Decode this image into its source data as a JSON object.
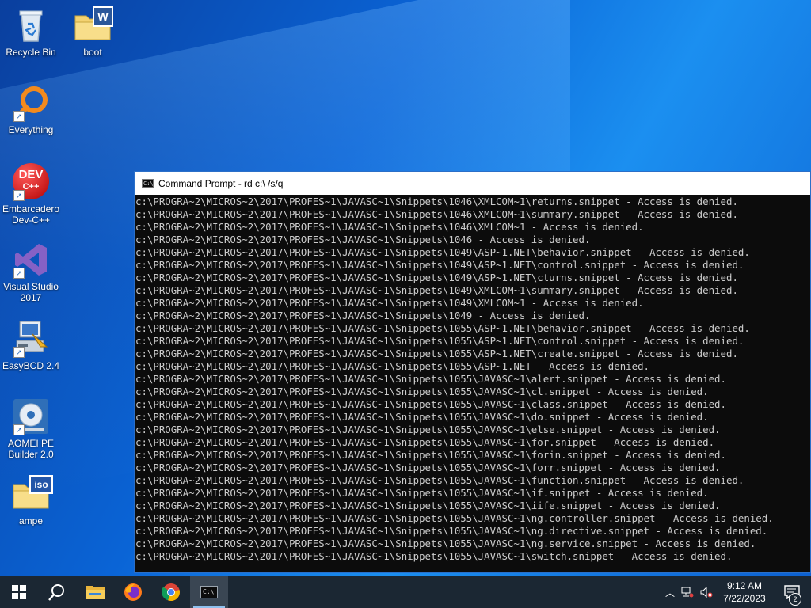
{
  "desktop": {
    "icons": [
      {
        "label": "Recycle Bin"
      },
      {
        "label": "boot"
      },
      {
        "label": "Everything"
      },
      {
        "label": "Embarcadero Dev-C++"
      },
      {
        "label": "Visual Studio 2017"
      },
      {
        "label": "EasyBCD 2.4"
      },
      {
        "label": "AOMEI PE Builder 2.0"
      },
      {
        "label": "ampe"
      }
    ],
    "boot_badge": "W",
    "ampe_badge": "iso",
    "devcpp_badge_top": "DEV",
    "devcpp_badge_bottom": "C++"
  },
  "cmd": {
    "title": "Command Prompt - rd  c:\\ /s/q",
    "icon_text": "C:\\",
    "lines": [
      "c:\\PROGRA~2\\MICROS~2\\2017\\PROFES~1\\JAVASC~1\\Snippets\\1046\\XMLCOM~1\\returns.snippet - Access is denied.",
      "c:\\PROGRA~2\\MICROS~2\\2017\\PROFES~1\\JAVASC~1\\Snippets\\1046\\XMLCOM~1\\summary.snippet - Access is denied.",
      "c:\\PROGRA~2\\MICROS~2\\2017\\PROFES~1\\JAVASC~1\\Snippets\\1046\\XMLCOM~1 - Access is denied.",
      "c:\\PROGRA~2\\MICROS~2\\2017\\PROFES~1\\JAVASC~1\\Snippets\\1046 - Access is denied.",
      "c:\\PROGRA~2\\MICROS~2\\2017\\PROFES~1\\JAVASC~1\\Snippets\\1049\\ASP~1.NET\\behavior.snippet - Access is denied.",
      "c:\\PROGRA~2\\MICROS~2\\2017\\PROFES~1\\JAVASC~1\\Snippets\\1049\\ASP~1.NET\\control.snippet - Access is denied.",
      "c:\\PROGRA~2\\MICROS~2\\2017\\PROFES~1\\JAVASC~1\\Snippets\\1049\\ASP~1.NET\\cturns.snippet - Access is denied.",
      "c:\\PROGRA~2\\MICROS~2\\2017\\PROFES~1\\JAVASC~1\\Snippets\\1049\\XMLCOM~1\\summary.snippet - Access is denied.",
      "c:\\PROGRA~2\\MICROS~2\\2017\\PROFES~1\\JAVASC~1\\Snippets\\1049\\XMLCOM~1 - Access is denied.",
      "c:\\PROGRA~2\\MICROS~2\\2017\\PROFES~1\\JAVASC~1\\Snippets\\1049 - Access is denied.",
      "c:\\PROGRA~2\\MICROS~2\\2017\\PROFES~1\\JAVASC~1\\Snippets\\1055\\ASP~1.NET\\behavior.snippet - Access is denied.",
      "c:\\PROGRA~2\\MICROS~2\\2017\\PROFES~1\\JAVASC~1\\Snippets\\1055\\ASP~1.NET\\control.snippet - Access is denied.",
      "c:\\PROGRA~2\\MICROS~2\\2017\\PROFES~1\\JAVASC~1\\Snippets\\1055\\ASP~1.NET\\create.snippet - Access is denied.",
      "c:\\PROGRA~2\\MICROS~2\\2017\\PROFES~1\\JAVASC~1\\Snippets\\1055\\ASP~1.NET - Access is denied.",
      "c:\\PROGRA~2\\MICROS~2\\2017\\PROFES~1\\JAVASC~1\\Snippets\\1055\\JAVASC~1\\alert.snippet - Access is denied.",
      "c:\\PROGRA~2\\MICROS~2\\2017\\PROFES~1\\JAVASC~1\\Snippets\\1055\\JAVASC~1\\cl.snippet - Access is denied.",
      "c:\\PROGRA~2\\MICROS~2\\2017\\PROFES~1\\JAVASC~1\\Snippets\\1055\\JAVASC~1\\class.snippet - Access is denied.",
      "c:\\PROGRA~2\\MICROS~2\\2017\\PROFES~1\\JAVASC~1\\Snippets\\1055\\JAVASC~1\\do.snippet - Access is denied.",
      "c:\\PROGRA~2\\MICROS~2\\2017\\PROFES~1\\JAVASC~1\\Snippets\\1055\\JAVASC~1\\else.snippet - Access is denied.",
      "c:\\PROGRA~2\\MICROS~2\\2017\\PROFES~1\\JAVASC~1\\Snippets\\1055\\JAVASC~1\\for.snippet - Access is denied.",
      "c:\\PROGRA~2\\MICROS~2\\2017\\PROFES~1\\JAVASC~1\\Snippets\\1055\\JAVASC~1\\forin.snippet - Access is denied.",
      "c:\\PROGRA~2\\MICROS~2\\2017\\PROFES~1\\JAVASC~1\\Snippets\\1055\\JAVASC~1\\forr.snippet - Access is denied.",
      "c:\\PROGRA~2\\MICROS~2\\2017\\PROFES~1\\JAVASC~1\\Snippets\\1055\\JAVASC~1\\function.snippet - Access is denied.",
      "c:\\PROGRA~2\\MICROS~2\\2017\\PROFES~1\\JAVASC~1\\Snippets\\1055\\JAVASC~1\\if.snippet - Access is denied.",
      "c:\\PROGRA~2\\MICROS~2\\2017\\PROFES~1\\JAVASC~1\\Snippets\\1055\\JAVASC~1\\iife.snippet - Access is denied.",
      "c:\\PROGRA~2\\MICROS~2\\2017\\PROFES~1\\JAVASC~1\\Snippets\\1055\\JAVASC~1\\ng.controller.snippet - Access is denied.",
      "c:\\PROGRA~2\\MICROS~2\\2017\\PROFES~1\\JAVASC~1\\Snippets\\1055\\JAVASC~1\\ng.directive.snippet - Access is denied.",
      "c:\\PROGRA~2\\MICROS~2\\2017\\PROFES~1\\JAVASC~1\\Snippets\\1055\\JAVASC~1\\ng.service.snippet - Access is denied.",
      "c:\\PROGRA~2\\MICROS~2\\2017\\PROFES~1\\JAVASC~1\\Snippets\\1055\\JAVASC~1\\switch.snippet - Access is denied."
    ]
  },
  "taskbar": {
    "clock_time": "9:12 AM",
    "clock_date": "7/22/2023",
    "notification_count": "2",
    "terminal_icon_text": "C:\\"
  },
  "colors": {
    "taskbar_bg": "#1b2733",
    "console_bg": "#0c0c0c",
    "console_fg": "#cccccc",
    "accent": "#8fc1ee"
  }
}
